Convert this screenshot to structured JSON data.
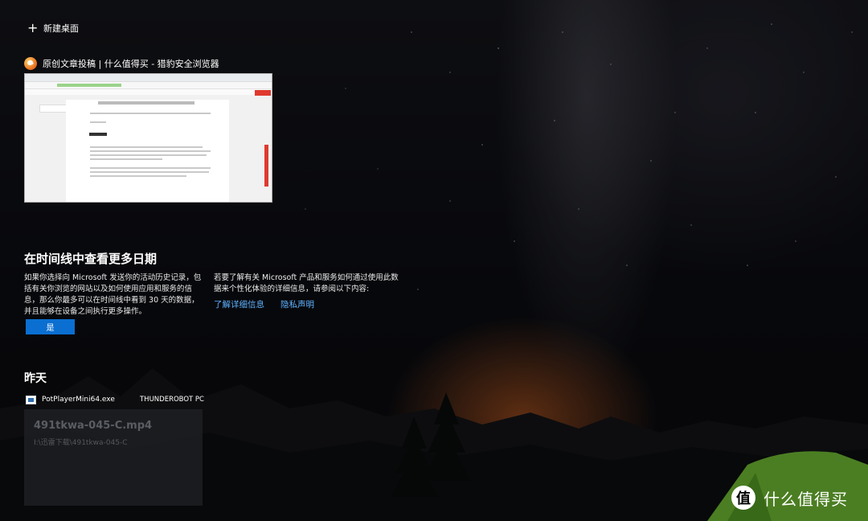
{
  "header": {
    "new_desktop_label": "新建桌面"
  },
  "window": {
    "title": "原创文章投稿 | 什么值得买 - 猎豹安全浏览器"
  },
  "timeline_prompt": {
    "title": "在时间线中查看更多日期",
    "description": "如果你选择向 Microsoft 发送你的活动历史记录，包括有关你浏览的网站以及如何使用应用和服务的信息，那么你最多可以在时间线中看到 30 天的数据，并且能够在设备之间执行更多操作。",
    "privacy_text": "若要了解有关 Microsoft 产品和服务如何通过使用此数据来个性化体验的详细信息，请参阅以下内容:",
    "learn_more_link": "了解详细信息",
    "privacy_link": "隐私声明",
    "yes_button": "是"
  },
  "yesterday": {
    "heading": "昨天",
    "app_name": "PotPlayerMini64.exe",
    "device": "THUNDEROBOT PC",
    "file_name": "491tkwa-045-C.mp4",
    "file_path": "I:\\迅雷下载\\491tkwa-045-C"
  },
  "watermark": {
    "logo_char": "值",
    "text": "什么值得买"
  },
  "colors": {
    "accent": "#0a6fd1",
    "link": "#5fb2ff",
    "tent": "#7fd63a"
  }
}
